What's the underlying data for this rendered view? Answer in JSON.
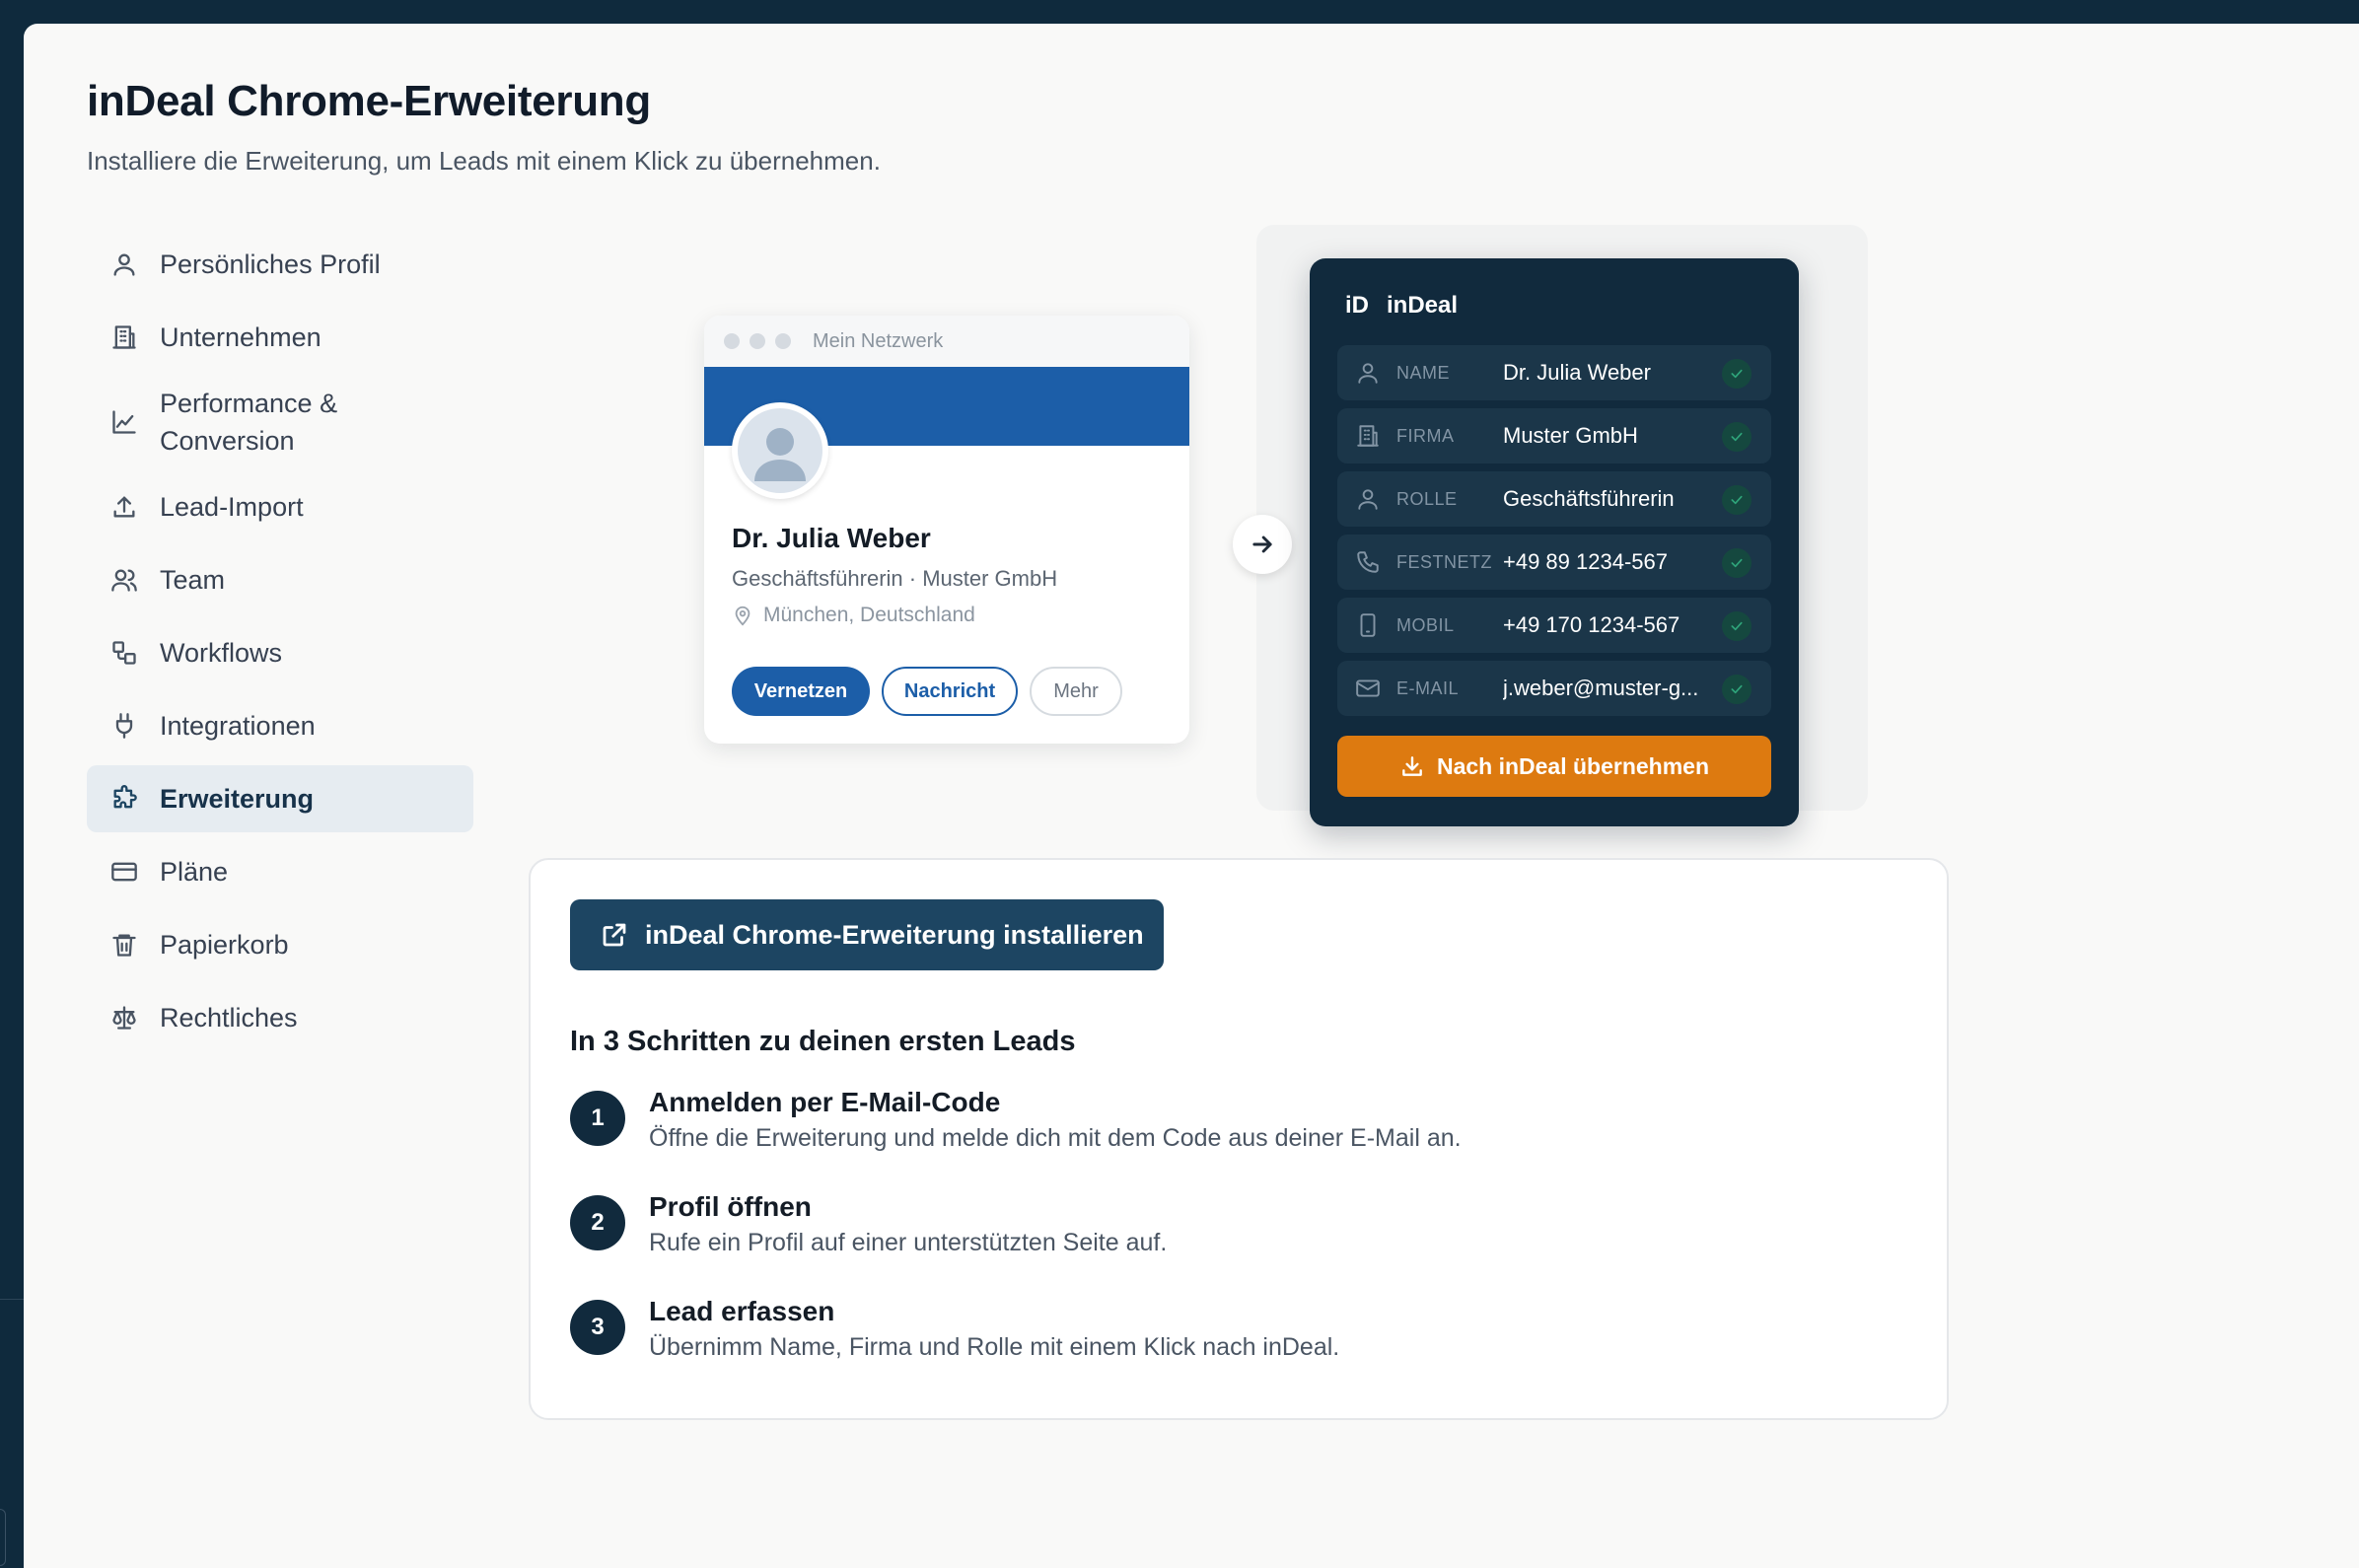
{
  "page": {
    "title": "inDeal Chrome-Erweiterung",
    "subtitle": "Installiere die Erweiterung, um Leads mit einem Klick zu übernehmen."
  },
  "sidebar": {
    "items": [
      {
        "label": "Persönliches Profil",
        "icon": "user-icon"
      },
      {
        "label": "Unternehmen",
        "icon": "building-icon"
      },
      {
        "label": "Performance & Conversion",
        "icon": "chart-line-icon"
      },
      {
        "label": "Lead-Import",
        "icon": "upload-icon"
      },
      {
        "label": "Team",
        "icon": "users-icon"
      },
      {
        "label": "Workflows",
        "icon": "workflow-icon"
      },
      {
        "label": "Integrationen",
        "icon": "plug-icon"
      },
      {
        "label": "Erweiterung",
        "icon": "puzzle-icon",
        "active": true
      },
      {
        "label": "Pläne",
        "icon": "credit-card-icon"
      },
      {
        "label": "Papierkorb",
        "icon": "trash-icon"
      },
      {
        "label": "Rechtliches",
        "icon": "scale-icon"
      }
    ]
  },
  "preview": {
    "profile_card": {
      "window_title": "Mein Netzwerk",
      "name": "Dr. Julia Weber",
      "role_company": "Geschäftsführerin · Muster GmbH",
      "location": "München, Deutschland",
      "buttons": {
        "connect": "Vernetzen",
        "message": "Nachricht",
        "more": "Mehr"
      },
      "banner_color": "#1c5ea8"
    },
    "extension": {
      "logo": "iD",
      "brand": "inDeal",
      "fields": [
        {
          "label": "NAME",
          "value": "Dr. Julia Weber",
          "icon": "user-icon"
        },
        {
          "label": "FIRMA",
          "value": "Muster GmbH",
          "icon": "building-icon"
        },
        {
          "label": "ROLLE",
          "value": "Geschäftsführerin",
          "icon": "user-icon"
        },
        {
          "label": "FESTNETZ",
          "value": "+49 89 1234-567",
          "icon": "phone-icon"
        },
        {
          "label": "MOBIL",
          "value": "+49 170 1234-567",
          "icon": "smartphone-icon"
        },
        {
          "label": "E-MAIL",
          "value": "j.weber@muster-g...",
          "icon": "mail-icon"
        }
      ],
      "submit_label": "Nach inDeal übernehmen",
      "accent_color": "#dd7a10",
      "background_color": "#112a3d"
    }
  },
  "install": {
    "button_label": "inDeal Chrome-Erweiterung installieren",
    "steps_title": "In 3 Schritten zu deinen ersten Leads",
    "steps": [
      {
        "number": "1",
        "title": "Anmelden per E-Mail-Code",
        "description": "Öffne die Erweiterung und melde dich mit dem Code aus deiner E-Mail an."
      },
      {
        "number": "2",
        "title": "Profil öffnen",
        "description": "Rufe ein Profil auf einer unterstützten Seite auf."
      },
      {
        "number": "3",
        "title": "Lead erfassen",
        "description": "Übernimm Name, Firma und Rolle mit einem Klick nach inDeal."
      }
    ]
  },
  "colors": {
    "primary": "#1d4562",
    "frame": "#0f2a3d",
    "active_nav_bg": "#e6ecf1"
  }
}
